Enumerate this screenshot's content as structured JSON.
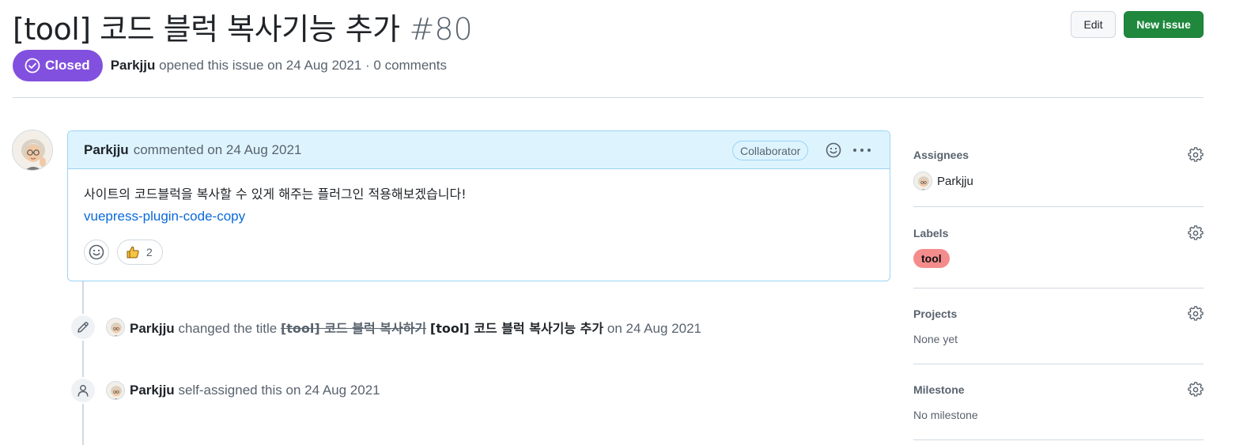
{
  "issue": {
    "title": "[tool] 코드 블럭 복사기능 추가",
    "number": "#80",
    "state": "Closed",
    "author": "Parkjju",
    "meta": "opened this issue on 24 Aug 2021 · 0 comments"
  },
  "toolbar": {
    "edit_label": "Edit",
    "new_issue_label": "New issue"
  },
  "comment": {
    "author": "Parkjju",
    "action": "commented on 24 Aug 2021",
    "role_badge": "Collaborator",
    "body": "사이트의 코드블럭을 복사할 수 있게 해주는 플러그인 적용해보겠습니다!",
    "link_text": "vuepress-plugin-code-copy",
    "reactions": [
      {
        "emoji": "thumbs-up",
        "count": "2"
      }
    ]
  },
  "timeline": [
    {
      "type": "renamed",
      "icon": "pencil-icon",
      "actor": "Parkjju",
      "verb": "changed the title",
      "old_title": "[tool] 코드 블럭 복사하기",
      "new_title": "[tool] 코드 블럭 복사기능 추가",
      "date": "on 24 Aug 2021"
    },
    {
      "type": "assigned",
      "icon": "person-icon",
      "actor": "Parkjju",
      "verb": "self-assigned this on 24 Aug 2021"
    }
  ],
  "sidebar": {
    "assignees": {
      "heading": "Assignees",
      "items": [
        "Parkjju"
      ]
    },
    "labels": {
      "heading": "Labels",
      "items": [
        {
          "name": "tool",
          "color": "#f58c8c"
        }
      ]
    },
    "projects": {
      "heading": "Projects",
      "value": "None yet"
    },
    "milestone": {
      "heading": "Milestone",
      "value": "No milestone"
    }
  },
  "colors": {
    "closed_purple": "#8250df",
    "primary_green": "#1f883d",
    "link_blue": "#0969da",
    "comment_header_bg": "#ddf4ff"
  }
}
